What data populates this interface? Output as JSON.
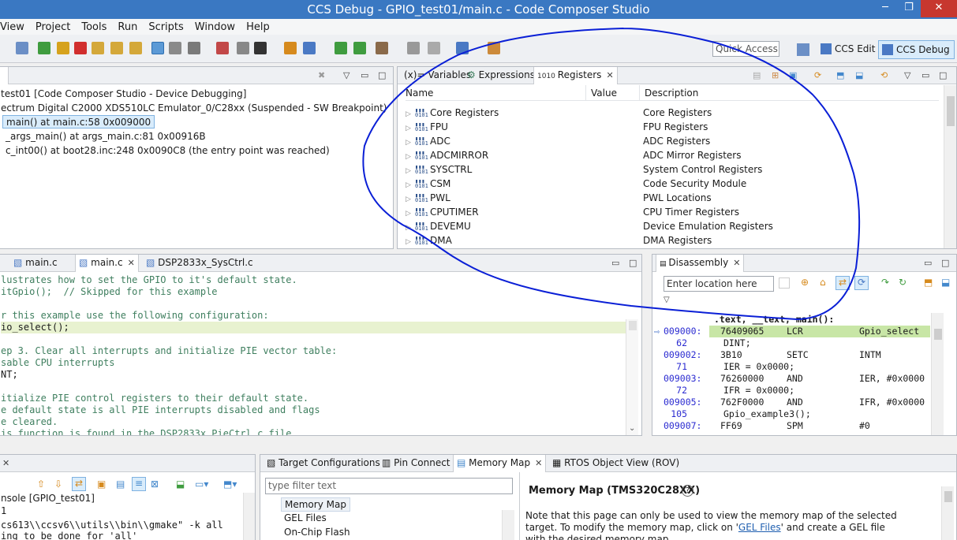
{
  "window": {
    "title": "CCS Debug - GPIO_test01/main.c - Code Composer Studio",
    "minimize_glyph": "─",
    "maximize_glyph": "❐",
    "close_glyph": "✕"
  },
  "menu": [
    "View",
    "Project",
    "Tools",
    "Run",
    "Scripts",
    "Window",
    "Help"
  ],
  "toolbar": {
    "quick_access": "Quick Access",
    "perspective_edit": "CCS Edit",
    "perspective_debug": "CCS Debug"
  },
  "debug_view": {
    "lines": [
      "test01 [Code Composer Studio - Device Debugging]",
      "ectrum Digital C2000 XDS510LC Emulator_0/C28xx (Suspended - SW Breakpoint)",
      "main() at main.c:58 0x009000",
      "_args_main() at args_main.c:81 0x00916B",
      "c_int00() at boot28.inc:248 0x0090C8  (the entry point was reached)"
    ]
  },
  "registers_view": {
    "tabs": [
      "(x)= Variables",
      "Expressions",
      "Registers"
    ],
    "columns": [
      "Name",
      "Value",
      "Description"
    ],
    "rows": [
      {
        "name": "Core Registers",
        "value": "",
        "desc": "Core Registers"
      },
      {
        "name": "FPU",
        "value": "",
        "desc": "FPU Registers"
      },
      {
        "name": "ADC",
        "value": "",
        "desc": "ADC Registers"
      },
      {
        "name": "ADCMIRROR",
        "value": "",
        "desc": "ADC Mirror Registers"
      },
      {
        "name": "SYSCTRL",
        "value": "",
        "desc": "System Control Registers"
      },
      {
        "name": "CSM",
        "value": "",
        "desc": "Code Security Module"
      },
      {
        "name": "PWL",
        "value": "",
        "desc": "PWL Locations"
      },
      {
        "name": "CPUTIMER",
        "value": "",
        "desc": "CPU Timer Registers"
      },
      {
        "name": "DEVEMU",
        "value": "",
        "desc": "Device Emulation Registers"
      },
      {
        "name": "DMA",
        "value": "",
        "desc": "DMA Registers"
      }
    ]
  },
  "editor": {
    "tabs": [
      "main.c",
      "main.c",
      "DSP2833x_SysCtrl.c"
    ],
    "lines": [
      {
        "text": "lustrates how to set the GPIO to it's default state.",
        "kind": "comment"
      },
      {
        "text": "itGpio();  // Skipped for this example",
        "kind": "comment"
      },
      {
        "text": "",
        "kind": "code"
      },
      {
        "text": "r this example use the following configuration:",
        "kind": "comment"
      },
      {
        "text": "io_select();",
        "kind": "highlight"
      },
      {
        "text": "",
        "kind": "code"
      },
      {
        "text": "ep 3. Clear all interrupts and initialize PIE vector table:",
        "kind": "comment"
      },
      {
        "text": "sable CPU interrupts",
        "kind": "comment"
      },
      {
        "text": "NT;",
        "kind": "code"
      },
      {
        "text": "",
        "kind": "code"
      },
      {
        "text": "itialize PIE control registers to their default state.",
        "kind": "comment"
      },
      {
        "text": "e default state is all PIE interrupts disabled and flags",
        "kind": "comment"
      },
      {
        "text": "e cleared.",
        "kind": "comment"
      },
      {
        "text": "is function is found in the DSP2833x_PieCtrl.c file.",
        "kind": "comment"
      }
    ]
  },
  "disassembly": {
    "tab": "Disassembly",
    "location_placeholder": "Enter location here",
    "header": ".text, __text, main():",
    "lines": [
      {
        "a": "009000:",
        "b": "76409065",
        "c": "LCR",
        "d": "Gpio_select",
        "kind": "asm",
        "current": true
      },
      {
        "a": "62",
        "b": "DINT;",
        "c": "",
        "d": "",
        "kind": "src"
      },
      {
        "a": "009002:",
        "b": "3B10",
        "c": "SETC",
        "d": "INTM",
        "kind": "asm"
      },
      {
        "a": "71",
        "b": "IER = 0x0000;",
        "c": "",
        "d": "",
        "kind": "src"
      },
      {
        "a": "009003:",
        "b": "76260000",
        "c": "AND",
        "d": "IER, #0x0000",
        "kind": "asm"
      },
      {
        "a": "72",
        "b": "IFR = 0x0000;",
        "c": "",
        "d": "",
        "kind": "src"
      },
      {
        "a": "009005:",
        "b": "762F0000",
        "c": "AND",
        "d": "IFR, #0x0000",
        "kind": "asm"
      },
      {
        "a": "105",
        "b": "Gpio_example3();",
        "c": "",
        "d": "",
        "kind": "src"
      },
      {
        "a": "009007:",
        "b": "FF69",
        "c": "SPM",
        "d": "#0",
        "kind": "asm"
      }
    ]
  },
  "console": {
    "title": "nsole [GPIO_test01]",
    "lines": [
      "1",
      "",
      "cs613\\\\ccsv6\\\\utils\\\\bin\\\\gmake\" -k all",
      "ing to be done for 'all'"
    ]
  },
  "target_tabs": [
    "Target Configurations",
    "Pin Connect",
    "Memory Map",
    "RTOS Object View (ROV)"
  ],
  "memory_map": {
    "filter_placeholder": "type filter text",
    "tree": [
      "Memory Map",
      "GEL Files",
      "On-Chip Flash"
    ],
    "title": "Memory Map (TMS320C28XX)",
    "help_glyph": "?",
    "desc1": "Note that this page can only be used to view the memory map of the selected",
    "desc2_a": "target.  To modify the memory map, click on '",
    "desc2_link": "GEL Files",
    "desc2_b": "' and create a GEL file",
    "desc3": "with the desired memory map."
  },
  "annotation_color": "#0a1fd6"
}
